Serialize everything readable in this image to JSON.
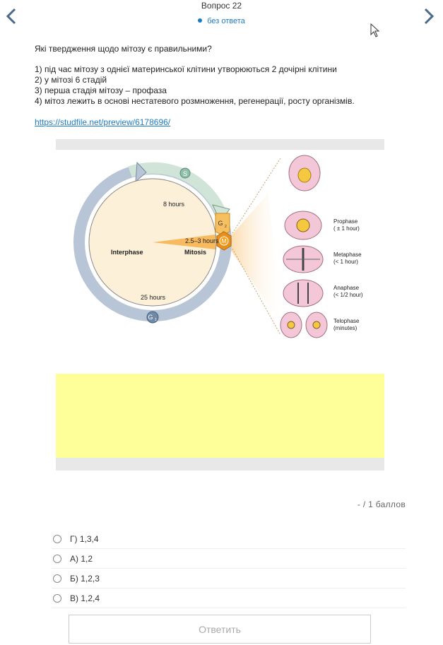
{
  "header": {
    "title": "Вопрос 22",
    "status": "без ответа"
  },
  "question": {
    "text": "Які твердження щодо мітозу є правильними?",
    "statements": [
      "1) під час мітозу з однієї материнської клітини утворюються 2 дочірні клітини",
      "2) у мітозі 6 стадій",
      "3) перша стадія мітозу – профаза",
      "4) мітоз лежить в основі нестатевого розмноження, регенерації, росту організмів."
    ],
    "link": "https://studfile.net/preview/6178696/"
  },
  "figure": {
    "interphase": "Interphase",
    "mitosis": "Mitosis",
    "s_label": "S",
    "g1_label": "G",
    "g1_sub": "1",
    "g2_label": "G",
    "g2_sub": "2",
    "m_label": "M",
    "plus": "+",
    "h8": "8 hours",
    "h25": "25 hours",
    "h253": "2.5–3 hours",
    "phases": [
      {
        "name": "Prophase",
        "duration": "( ± 1 hour)"
      },
      {
        "name": "Metaphase",
        "duration": "(< 1 hour)"
      },
      {
        "name": "Anaphase",
        "duration": "(< 1/2 hour)"
      },
      {
        "name": "Telophase",
        "duration": "(minutes)"
      }
    ]
  },
  "score": {
    "value": "-",
    "sep": "/",
    "max": "1",
    "unit": "баллов"
  },
  "options": [
    {
      "label": "Г) 1,3,4"
    },
    {
      "label": "А) 1,2"
    },
    {
      "label": "Б) 1,2,3"
    },
    {
      "label": "В) 1,2,4"
    }
  ],
  "submit_label": "Ответить",
  "colors": {
    "accent": "#1b7cc4"
  }
}
